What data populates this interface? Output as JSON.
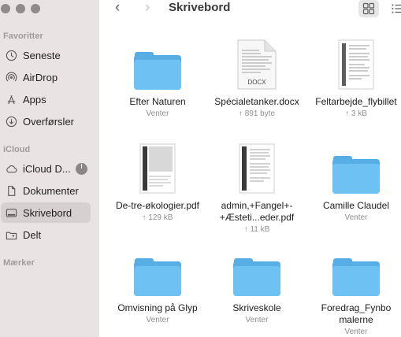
{
  "window": {
    "title": "Skrivebord"
  },
  "sidebar": {
    "favorites_title": "Favoritter",
    "icloud_title": "iCloud",
    "tags_title": "Mærker",
    "favorites": [
      {
        "label": "Seneste",
        "icon": "clock-icon"
      },
      {
        "label": "AirDrop",
        "icon": "airdrop-icon"
      },
      {
        "label": "Apps",
        "icon": "apps-icon"
      },
      {
        "label": "Overførsler",
        "icon": "download-icon"
      }
    ],
    "icloud": [
      {
        "label": "iCloud D...",
        "icon": "cloud-icon"
      },
      {
        "label": "Dokumenter",
        "icon": "document-icon"
      },
      {
        "label": "Skrivebord",
        "icon": "desktop-icon",
        "selected": true
      },
      {
        "label": "Delt",
        "icon": "shared-folder-icon"
      }
    ]
  },
  "files": [
    {
      "name": "Efter Naturen",
      "meta": "Venter",
      "kind": "folder"
    },
    {
      "name": "Spécialetanker.docx",
      "meta": "↑ 891 byte",
      "kind": "docx",
      "badge": "DOCX"
    },
    {
      "name": "Feltarbejde_flybillet",
      "meta": "↑ 3 kB",
      "kind": "document"
    },
    {
      "name": "De-tre-økologier.pdf",
      "meta": "↑ 129 kB",
      "kind": "pdf"
    },
    {
      "name": "admin,+Fangel+-+Æsteti...eder.pdf",
      "meta": "↑ 11 kB",
      "kind": "pdf"
    },
    {
      "name": "Camille Claudel",
      "meta": "Venter",
      "kind": "folder"
    },
    {
      "name": "Omvisning på Glyp",
      "meta": "Venter",
      "kind": "folder"
    },
    {
      "name": "Skriveskole",
      "meta": "Venter",
      "kind": "folder"
    },
    {
      "name": "Foredrag_Fynbo malerne",
      "meta": "Venter",
      "kind": "folder"
    }
  ],
  "colors": {
    "folder": "#6ec2f3",
    "sidebar": "#e9e4e3",
    "selection": "#d6d1d0"
  }
}
